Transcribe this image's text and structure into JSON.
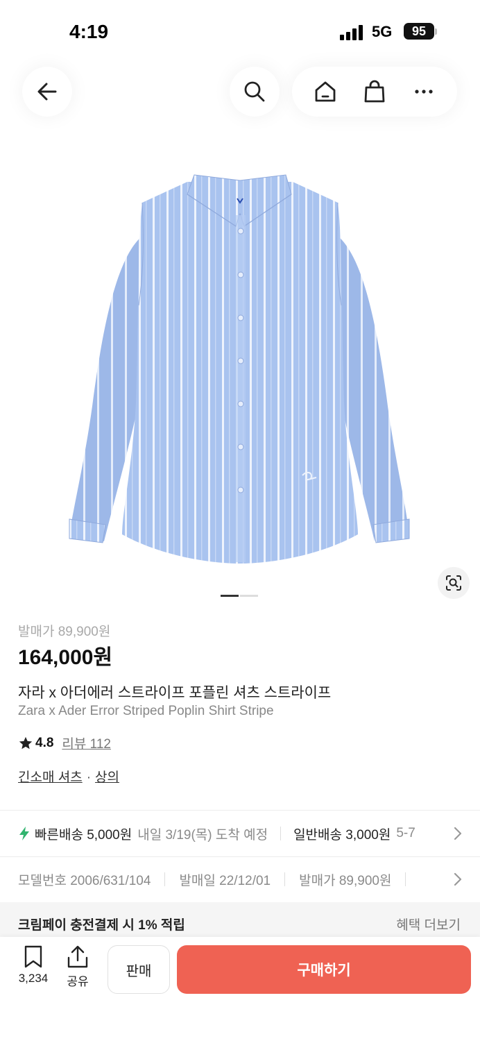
{
  "status_bar": {
    "time": "4:19",
    "network": "5G",
    "battery": "95"
  },
  "nav": {
    "back_icon": "arrow-left-icon",
    "search_icon": "search-icon",
    "home_icon": "home-icon",
    "bag_icon": "shopping-bag-icon",
    "more_icon": "more-dots-icon"
  },
  "product": {
    "image_icon": "striped-shirt-image",
    "image_pages": 2,
    "image_current": 1,
    "lens_icon": "image-search-icon",
    "original_price": "발매가 89,900원",
    "price": "164,000원",
    "title_ko": "자라 x 아더에러 스트라이프 포플린 셔츠 스트라이프",
    "title_en": "Zara x Ader Error Striped Poplin Shirt Stripe",
    "rating": "4.8",
    "review_label": "리뷰 112",
    "category_1": "긴소매 셔츠",
    "category_sep": "·",
    "category_2": "상의"
  },
  "shipping": {
    "fast_label": "빠른배송 5,000원",
    "fast_eta": "내일 3/19(목) 도착 예정",
    "normal_label": "일반배송 3,000원",
    "normal_eta": "5-7"
  },
  "meta": {
    "model": "모델번호 2006/631/104",
    "release_date": "발매일 22/12/01",
    "release_price": "발매가 89,900원"
  },
  "benefit": {
    "label": "크림페이 충전결제 시 1% 적립",
    "more": "혜택 더보기"
  },
  "bottom_bar": {
    "bookmark_count": "3,234",
    "share_label": "공유",
    "sell_label": "판매",
    "buy_label": "구매하기"
  },
  "colors": {
    "buy_button": "#ef6253",
    "shirt_blue": "#a9c3ef",
    "fast_ship_green": "#31b46e"
  }
}
